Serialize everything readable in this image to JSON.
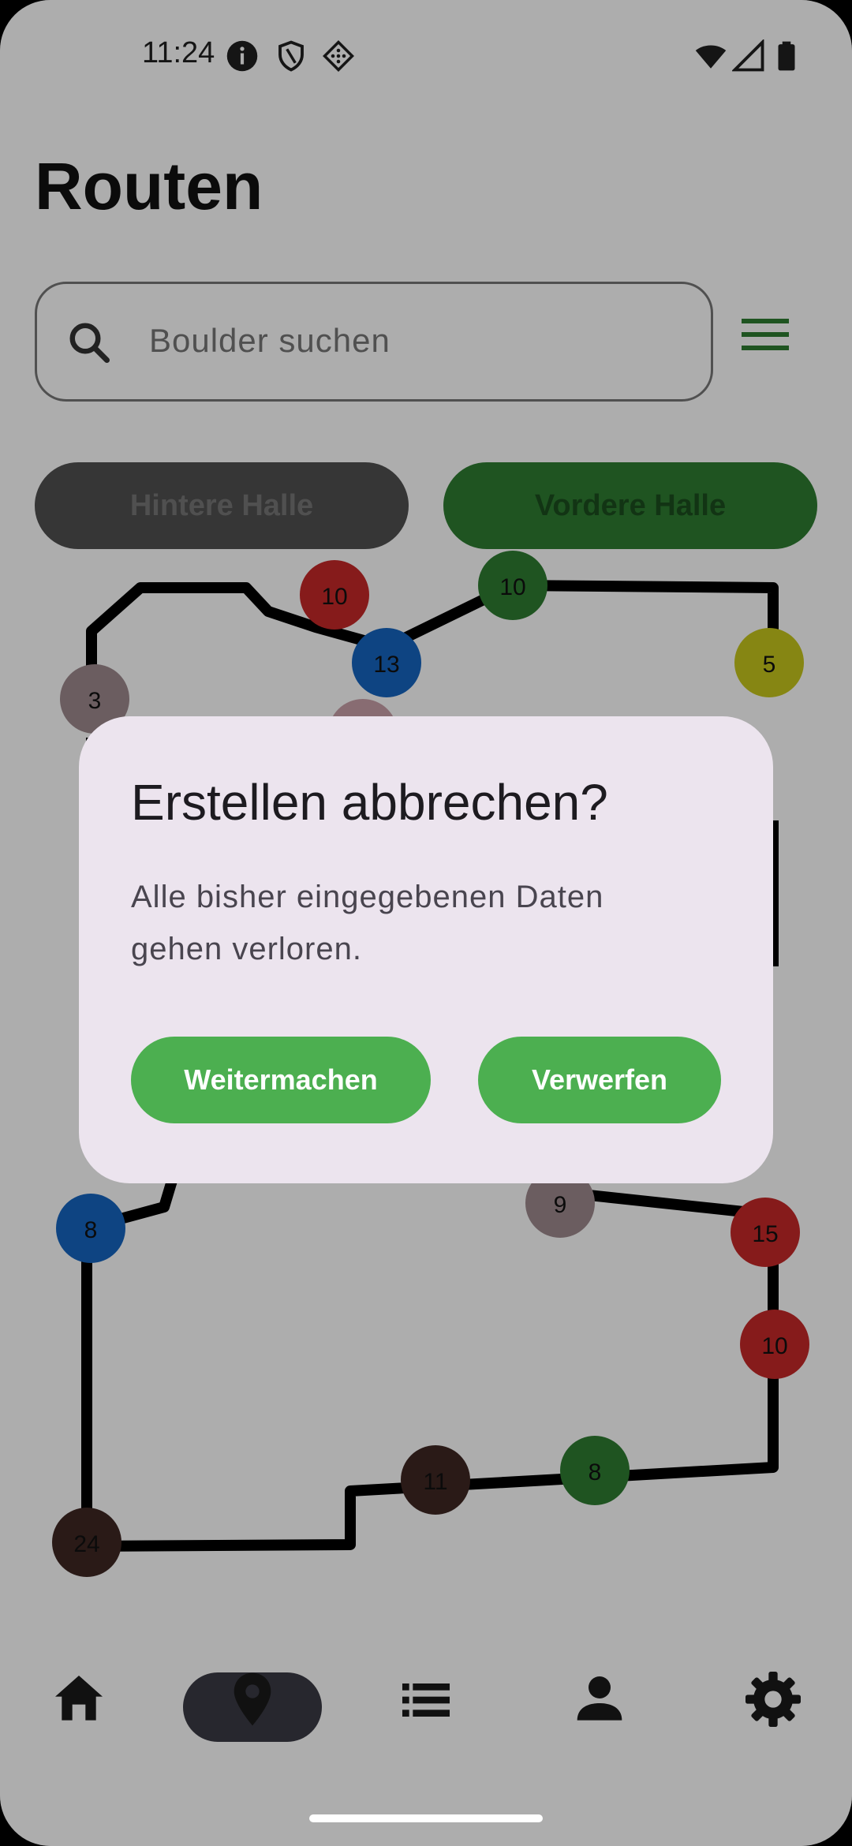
{
  "status_bar": {
    "time": "11:24"
  },
  "page": {
    "title": "Routen"
  },
  "search": {
    "placeholder": "Boulder suchen"
  },
  "halls": {
    "back_label": "Hintere Halle",
    "front_label": "Vordere Halle",
    "selected": "Vordere Halle"
  },
  "map_markers": [
    {
      "label": "10",
      "color": "#c62828"
    },
    {
      "label": "10",
      "color": "#2e7d32"
    },
    {
      "label": "13",
      "color": "#1565c0"
    },
    {
      "label": "5",
      "color": "#c6c61c"
    },
    {
      "label": "3",
      "color": "#9e8a8e"
    },
    {
      "label": "8",
      "color": "#1565c0"
    },
    {
      "label": "9",
      "color": "#9e8a8e"
    },
    {
      "label": "15",
      "color": "#c62828"
    },
    {
      "label": "10",
      "color": "#c62828"
    },
    {
      "label": "11",
      "color": "#3e2723"
    },
    {
      "label": "8",
      "color": "#2e7d32"
    },
    {
      "label": "24",
      "color": "#3e2723"
    }
  ],
  "dialog": {
    "title": "Erstellen abbrechen?",
    "body": "Alle bisher eingegebenen Daten gehen verloren.",
    "continue_label": "Weitermachen",
    "discard_label": "Verwerfen"
  },
  "colors": {
    "accent": "#4caf50",
    "dialog_bg": "#ece4ee",
    "selected_hall": "#2e7d32"
  },
  "bottom_nav": {
    "items": [
      {
        "icon": "home-icon"
      },
      {
        "icon": "map-pin-icon",
        "selected": true
      },
      {
        "icon": "list-icon"
      },
      {
        "icon": "person-icon"
      },
      {
        "icon": "gear-icon"
      }
    ]
  }
}
